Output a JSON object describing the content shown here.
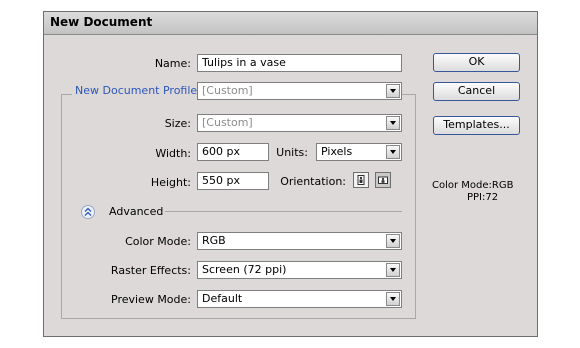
{
  "dialog": {
    "title": "New Document"
  },
  "form": {
    "name_label": "Name:",
    "name_value": "Tulips in a vase",
    "profile_label": "New Document Profile:",
    "profile_value": "[Custom]",
    "size_label": "Size:",
    "size_value": "[Custom]",
    "width_label": "Width:",
    "width_value": "600 px",
    "units_label": "Units:",
    "units_value": "Pixels",
    "height_label": "Height:",
    "height_value": "550 px",
    "orientation_label": "Orientation:",
    "advanced_label": "Advanced",
    "color_mode_label": "Color Mode:",
    "color_mode_value": "RGB",
    "raster_label": "Raster Effects:",
    "raster_value": "Screen (72 ppi)",
    "preview_label": "Preview Mode:",
    "preview_value": "Default"
  },
  "buttons": {
    "ok": "OK",
    "cancel": "Cancel",
    "templates": "Templates..."
  },
  "info": {
    "color_mode": "Color Mode:RGB",
    "ppi": "PPI:72"
  },
  "colors": {
    "profile_label": "#2e56b8",
    "dialog_bg": "#ddd9d9",
    "button_border": "#38579a"
  }
}
